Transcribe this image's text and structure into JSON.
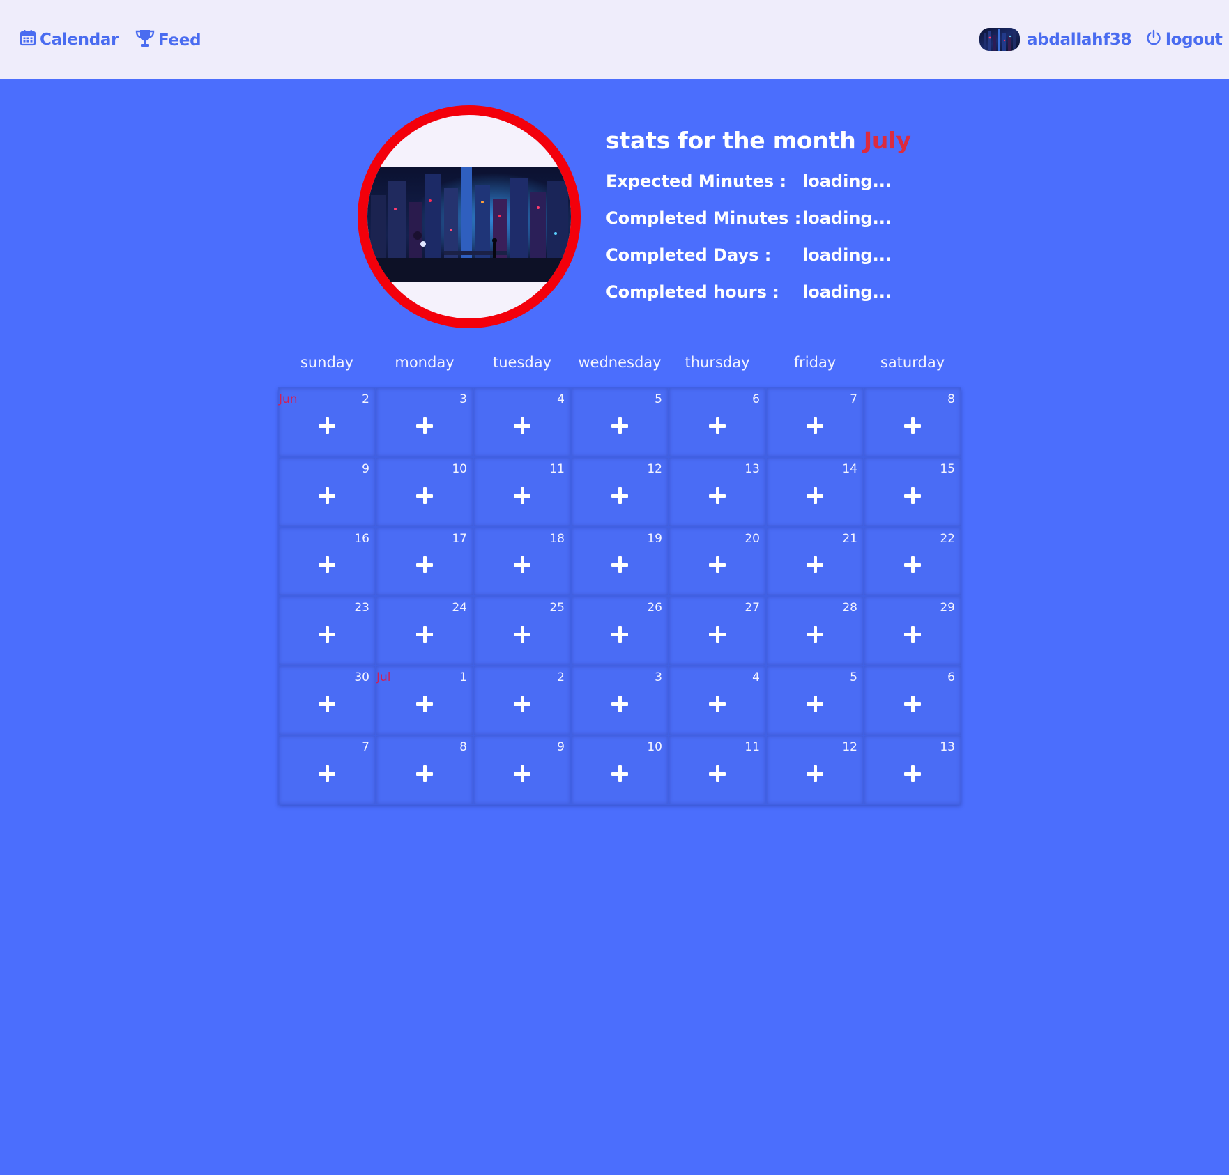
{
  "nav": {
    "calendar_label": "Calendar",
    "calendar_icon": "calendar-icon",
    "feed_label": "Feed",
    "feed_icon": "trophy-icon",
    "username": "abdallahf38",
    "logout_label": "logout",
    "logout_icon": "power-icon"
  },
  "stats": {
    "title_prefix": "stats for the month",
    "month": "July",
    "rows": [
      {
        "label": "Expected Minutes :",
        "value": "loading..."
      },
      {
        "label": "Completed Minutes :",
        "value": "loading..."
      },
      {
        "label": "Completed Days :",
        "value": "loading..."
      },
      {
        "label": "Completed hours :",
        "value": "loading..."
      }
    ]
  },
  "calendar": {
    "weekdays": [
      "sunday",
      "monday",
      "tuesday",
      "wednesday",
      "thursday",
      "friday",
      "saturday"
    ],
    "days": [
      {
        "day": "2",
        "month_tag": "Jun"
      },
      {
        "day": "3"
      },
      {
        "day": "4"
      },
      {
        "day": "5"
      },
      {
        "day": "6"
      },
      {
        "day": "7"
      },
      {
        "day": "8"
      },
      {
        "day": "9"
      },
      {
        "day": "10"
      },
      {
        "day": "11"
      },
      {
        "day": "12"
      },
      {
        "day": "13"
      },
      {
        "day": "14"
      },
      {
        "day": "15"
      },
      {
        "day": "16"
      },
      {
        "day": "17"
      },
      {
        "day": "18"
      },
      {
        "day": "19"
      },
      {
        "day": "20"
      },
      {
        "day": "21"
      },
      {
        "day": "22"
      },
      {
        "day": "23"
      },
      {
        "day": "24"
      },
      {
        "day": "25"
      },
      {
        "day": "26"
      },
      {
        "day": "27"
      },
      {
        "day": "28"
      },
      {
        "day": "29"
      },
      {
        "day": "30"
      },
      {
        "day": "1",
        "month_tag": "Jul"
      },
      {
        "day": "2"
      },
      {
        "day": "3"
      },
      {
        "day": "4"
      },
      {
        "day": "5"
      },
      {
        "day": "6"
      },
      {
        "day": "7"
      },
      {
        "day": "8"
      },
      {
        "day": "9"
      },
      {
        "day": "10"
      },
      {
        "day": "11"
      },
      {
        "day": "12"
      },
      {
        "day": "13"
      }
    ],
    "add_icon": "plus-icon"
  },
  "colors": {
    "background": "#4b6efd",
    "navbar": "#efedfb",
    "nav_text": "#4a6cf0",
    "ring": "#f3000b",
    "month_highlight": "#dc2b3e",
    "month_tag": "#d11f56"
  }
}
